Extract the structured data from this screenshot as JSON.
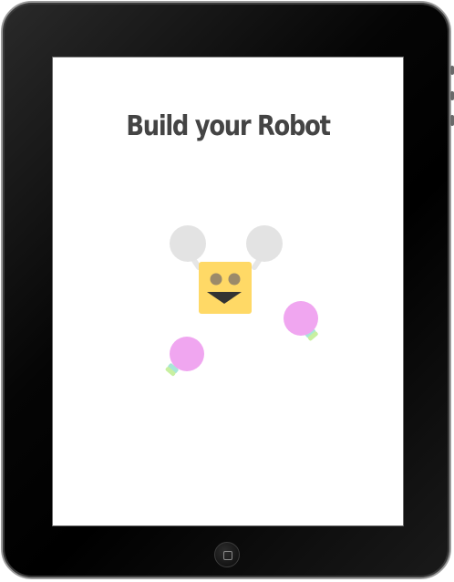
{
  "app": {
    "title": "Build your Robot"
  },
  "robot": {
    "head": {
      "color": "#ffd966",
      "eye_color": "#9b8a6a",
      "mouth_color": "#333333"
    },
    "antenna_balls": {
      "color": "#e3e3e3"
    },
    "hands": {
      "color": "#f0a6f0",
      "cuff_color": "#a8e6d8",
      "wrist_color": "#c8f0a0"
    }
  },
  "device": {
    "frame_color": "#000000",
    "screen_color": "#ffffff"
  }
}
